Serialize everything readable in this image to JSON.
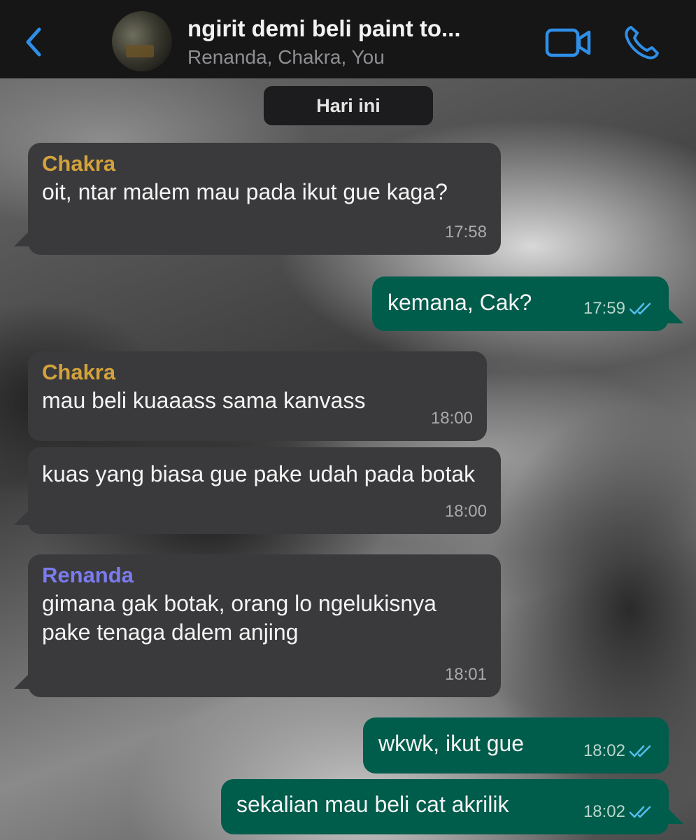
{
  "header": {
    "title": "ngirit demi beli paint to...",
    "subtitle": "Renanda, Chakra, You",
    "icons": [
      "chevron-left-icon",
      "group-avatar",
      "video-call-icon",
      "phone-icon"
    ],
    "accent_color": "#2f8fe8"
  },
  "date_divider": "Hari ini",
  "messages": [
    {
      "direction": "in",
      "sender": "Chakra",
      "text": "oit, ntar malem mau pada ikut gue kaga?",
      "time": "17:58"
    },
    {
      "direction": "out",
      "text": "kemana, Cak?",
      "time": "17:59",
      "read": true
    },
    {
      "direction": "in",
      "sender": "Chakra",
      "text": "mau beli kuaaass sama kanvass",
      "time": "18:00"
    },
    {
      "direction": "in",
      "text": "kuas yang biasa gue pake udah pada botak",
      "time": "18:00"
    },
    {
      "direction": "in",
      "sender": "Renanda",
      "text": "gimana gak botak, orang lo ngelukisnya pake tenaga dalem anjing",
      "time": "18:01"
    },
    {
      "direction": "out",
      "text": "wkwk, ikut gue",
      "time": "18:02",
      "read": true
    },
    {
      "direction": "out",
      "text": "sekalian mau beli cat akrilik",
      "time": "18:02",
      "read": true
    }
  ],
  "colors": {
    "incoming_bubble": "#3a3a3c",
    "outgoing_bubble": "#005c4b",
    "chakra_name": "#d3a23b",
    "renanda_name": "#7b7bf0",
    "read_ticks": "#53bdeb"
  }
}
